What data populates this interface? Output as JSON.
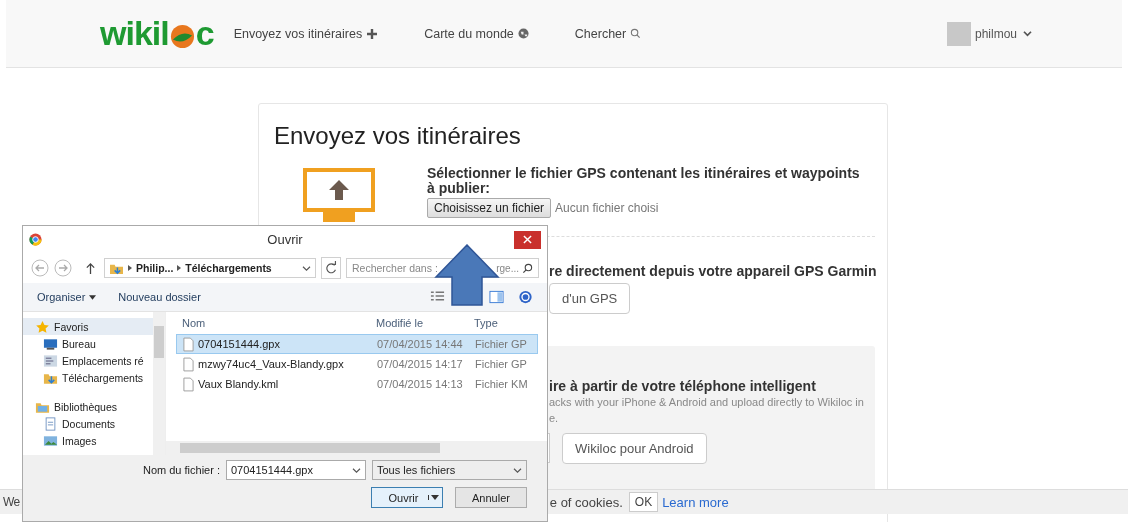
{
  "header": {
    "logo": {
      "before": "wikil",
      "after": "c"
    },
    "nav": [
      {
        "label": "Envoyez vos itinéraires"
      },
      {
        "label": "Carte du monde"
      },
      {
        "label": "Chercher"
      }
    ],
    "user": {
      "name": "philmou"
    }
  },
  "upload": {
    "title": "Envoyez vos itinéraires",
    "file_section": {
      "label": "Sélectionner le fichier GPS contenant les itinéraires et waypoints à publier:",
      "button": "Choisissez un fichier",
      "status": "Aucun fichier choisi"
    },
    "garmin_section": {
      "heading": "re directement depuis votre appareil GPS Garmin",
      "button": "d'un GPS"
    },
    "phone_section": {
      "heading": "ire à partir de votre téléphone intelligent",
      "description_lines": [
        "acks with your iPhone & Android and upload directly to Wikiloc in",
        "e."
      ],
      "android_button": "Wikiloc pour Android"
    }
  },
  "cookie_bar": {
    "lead": "We",
    "text": "e of cookies.",
    "ok": "OK",
    "link": "Learn more"
  },
  "dialog": {
    "title": "Ouvrir",
    "path": [
      "Philip...",
      "Téléchargements"
    ],
    "search": [
      "Rechercher dans :",
      "rge..."
    ],
    "toolbar": [
      "Organiser",
      "Nouveau dossier"
    ],
    "nav": [
      {
        "label": "Favoris",
        "selected": true,
        "children": [
          {
            "label": "Bureau",
            "selected": false
          },
          {
            "label": "Emplacements ré",
            "selected": false
          },
          {
            "label": "Téléchargements",
            "selected": false
          }
        ]
      },
      {
        "label": "Bibliothèques",
        "selected": false,
        "children": [
          {
            "label": "Documents",
            "selected": false
          },
          {
            "label": "Images",
            "selected": false
          }
        ]
      }
    ],
    "columns": [
      "Nom",
      "Modifié le",
      "Type"
    ],
    "files": [
      {
        "name": "0704151444.gpx",
        "modified": "07/04/2015 14:44",
        "type": "Fichier GP",
        "selected": true
      },
      {
        "name": "mzwy74uc4_Vaux-Blandy.gpx",
        "modified": "07/04/2015 14:17",
        "type": "Fichier GP",
        "selected": false
      },
      {
        "name": "Vaux Blandy.kml",
        "modified": "07/04/2015 14:13",
        "type": "Fichier KM",
        "selected": false
      }
    ],
    "filename_label": "Nom du fichier :",
    "filename": "0704151444.gpx",
    "filter": "Tous les fichiers",
    "buttons": [
      "Ouvrir",
      "Annuler"
    ]
  }
}
